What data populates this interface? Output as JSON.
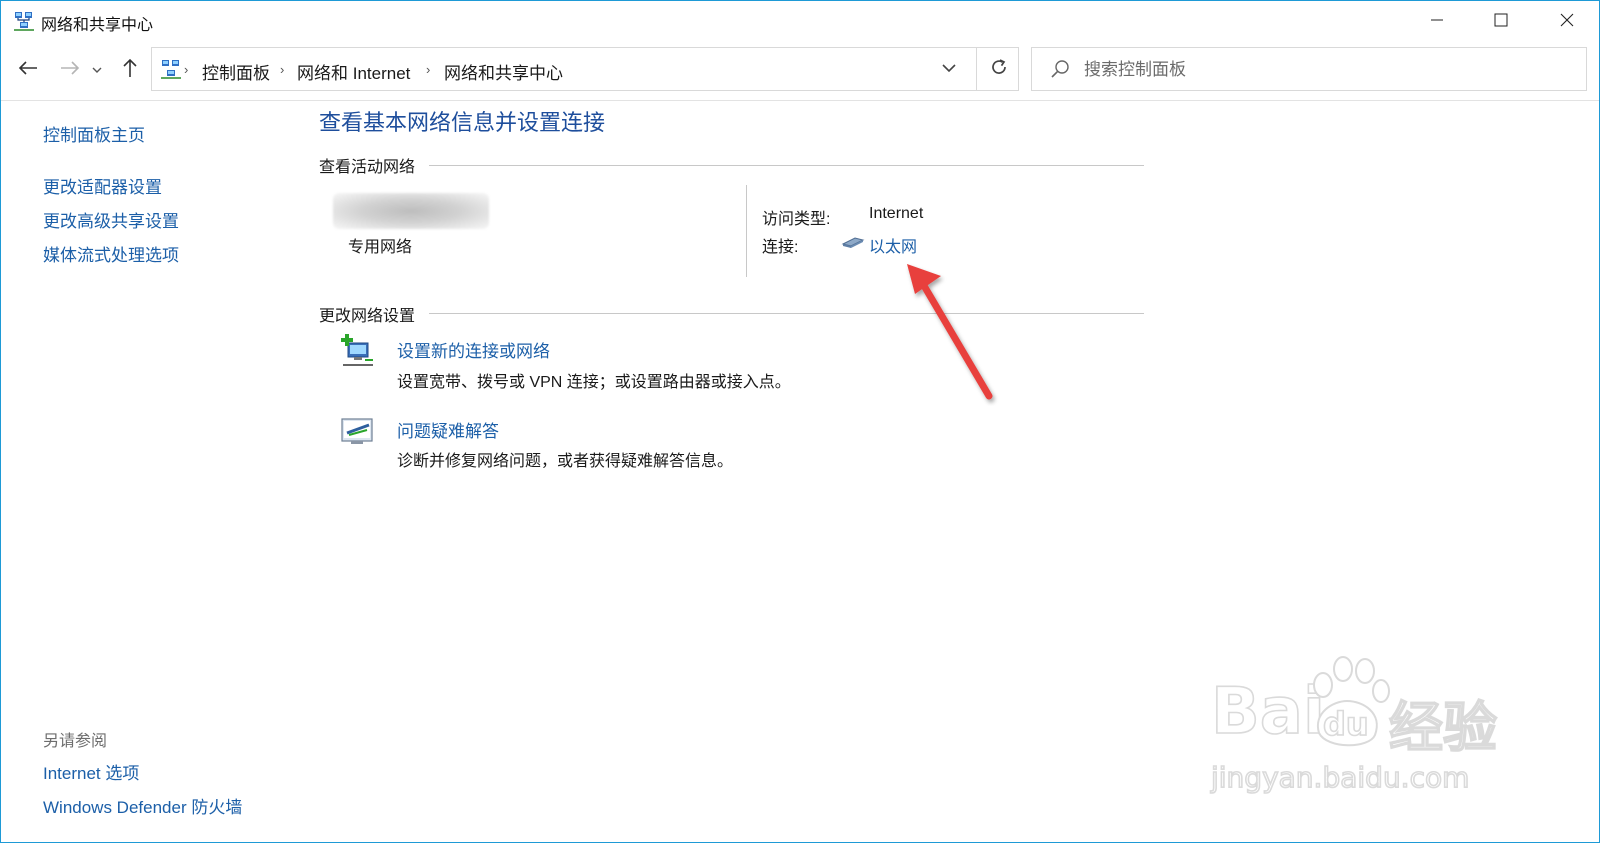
{
  "window": {
    "title": "网络和共享中心"
  },
  "nav": {
    "breadcrumbs": [
      "控制面板",
      "网络和 Internet",
      "网络和共享中心"
    ],
    "search_placeholder": "搜索控制面板"
  },
  "sidebar": {
    "home": "控制面板主页",
    "links": [
      "更改适配器设置",
      "更改高级共享设置",
      "媒体流式处理选项"
    ],
    "see_also_heading": "另请参阅",
    "see_also": [
      "Internet 选项",
      "Windows Defender 防火墙"
    ]
  },
  "main": {
    "title": "查看基本网络信息并设置连接",
    "active_networks": {
      "heading": "查看活动网络",
      "network_type": "专用网络",
      "access_type_label": "访问类型:",
      "access_type_value": "Internet",
      "connection_label": "连接:",
      "connection_value": "以太网"
    },
    "change_settings": {
      "heading": "更改网络设置",
      "tasks": [
        {
          "title": "设置新的连接或网络",
          "desc": "设置宽带、拨号或 VPN 连接；或设置路由器或接入点。",
          "icon": "new-connection-icon"
        },
        {
          "title": "问题疑难解答",
          "desc": "诊断并修复网络问题，或者获得疑难解答信息。",
          "icon": "troubleshoot-icon"
        }
      ]
    }
  },
  "watermark": {
    "brand": "Bai",
    "brand2": "du",
    "brand_cn": "经验",
    "url": "jingyan.baidu.com"
  },
  "colors": {
    "link": "#1c5fa8",
    "title": "#1e4e9c",
    "annotation_arrow": "#e8413e",
    "window_border": "#1e9ad6"
  }
}
